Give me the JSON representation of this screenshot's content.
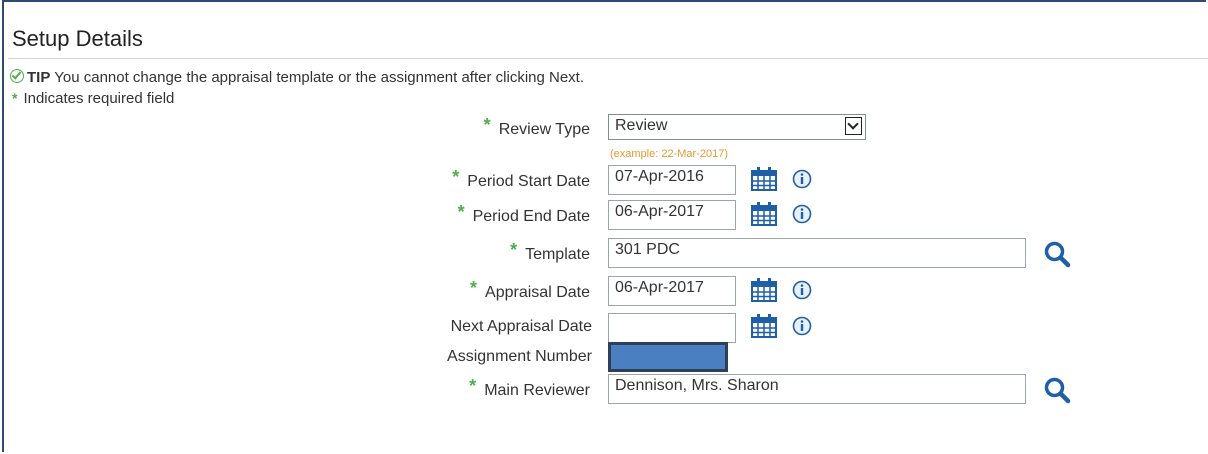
{
  "section": {
    "title": "Setup Details"
  },
  "tip": {
    "keyword": "TIP",
    "text": "You cannot change the appraisal template or the assignment after clicking Next."
  },
  "required_note": {
    "star": "*",
    "text": "Indicates required field"
  },
  "form": {
    "review_type": {
      "label": "Review Type",
      "value": "Review",
      "required": true
    },
    "date_example": "(example: 22-Mar-2017)",
    "period_start": {
      "label": "Period Start Date",
      "value": "07-Apr-2016",
      "required": true
    },
    "period_end": {
      "label": "Period End Date",
      "value": "06-Apr-2017",
      "required": true
    },
    "template": {
      "label": "Template",
      "value": "301 PDC",
      "required": true
    },
    "appraisal_date": {
      "label": "Appraisal Date",
      "value": "06-Apr-2017",
      "required": true
    },
    "next_appraisal_date": {
      "label": "Next Appraisal Date",
      "value": "",
      "required": false
    },
    "assignment_number": {
      "label": "Assignment Number",
      "value": ""
    },
    "main_reviewer": {
      "label": "Main Reviewer",
      "value": "Dennison, Mrs. Sharon",
      "required": true
    }
  },
  "icons": {
    "calendar": "calendar-icon",
    "info": "info-icon",
    "search": "search-icon",
    "tip": "check-circle-icon"
  },
  "colors": {
    "required_star": "#4cae4c",
    "example_text": "#e29a2e",
    "icon_blue": "#1f5fa8",
    "assignment_fill": "#4a7fc1"
  }
}
